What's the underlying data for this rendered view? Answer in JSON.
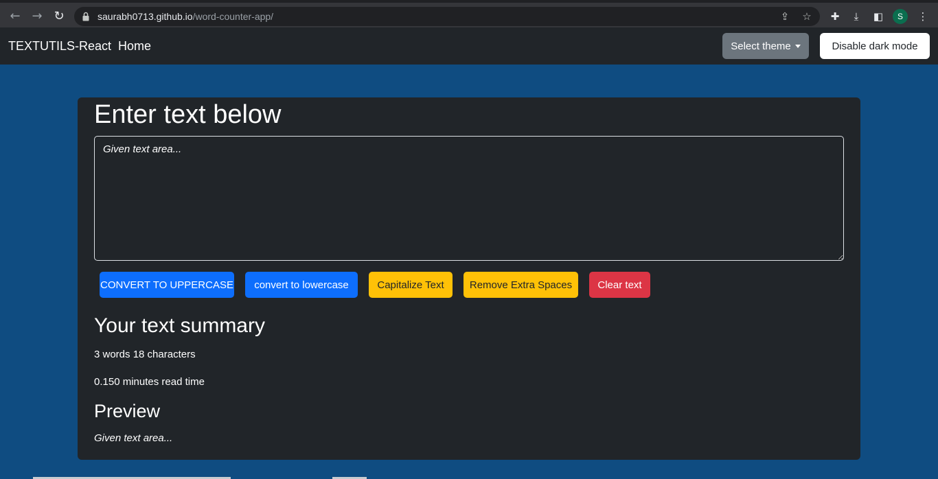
{
  "browser": {
    "url_host": "saurabh0713.github.io",
    "url_path": "/word-counter-app/",
    "profile_initial": "S",
    "icons": [
      "back-arrow-icon",
      "forward-arrow-icon",
      "reload-icon",
      "lock-icon",
      "share-icon",
      "star-icon",
      "puzzle-icon",
      "download-icon",
      "sidepanel-icon",
      "more-vert-icon"
    ]
  },
  "navbar": {
    "brand": "TEXTUTILS-React",
    "home": "Home",
    "theme_button": "Select theme",
    "dark_mode_button": "Disable dark mode"
  },
  "main": {
    "heading": "Enter text below",
    "textarea_value": "Given text area...",
    "buttons": {
      "uppercase": "CONVERT TO UPPERCASE",
      "lowercase": "convert to lowercase",
      "capitalize": "Capitalize Text",
      "remove_spaces": "Remove Extra Spaces",
      "clear": "Clear text"
    },
    "summary_title": "Your text summary",
    "word_char_count": "3 words 18 characters",
    "read_time": "0.150 minutes read time",
    "preview_title": "Preview",
    "preview_text": "Given text area..."
  },
  "colors": {
    "page_background": "#0f4c81",
    "card_background": "#212529",
    "primary": "#0d6efd",
    "warning": "#ffc107",
    "danger": "#dc3545",
    "secondary": "#6c757d"
  }
}
